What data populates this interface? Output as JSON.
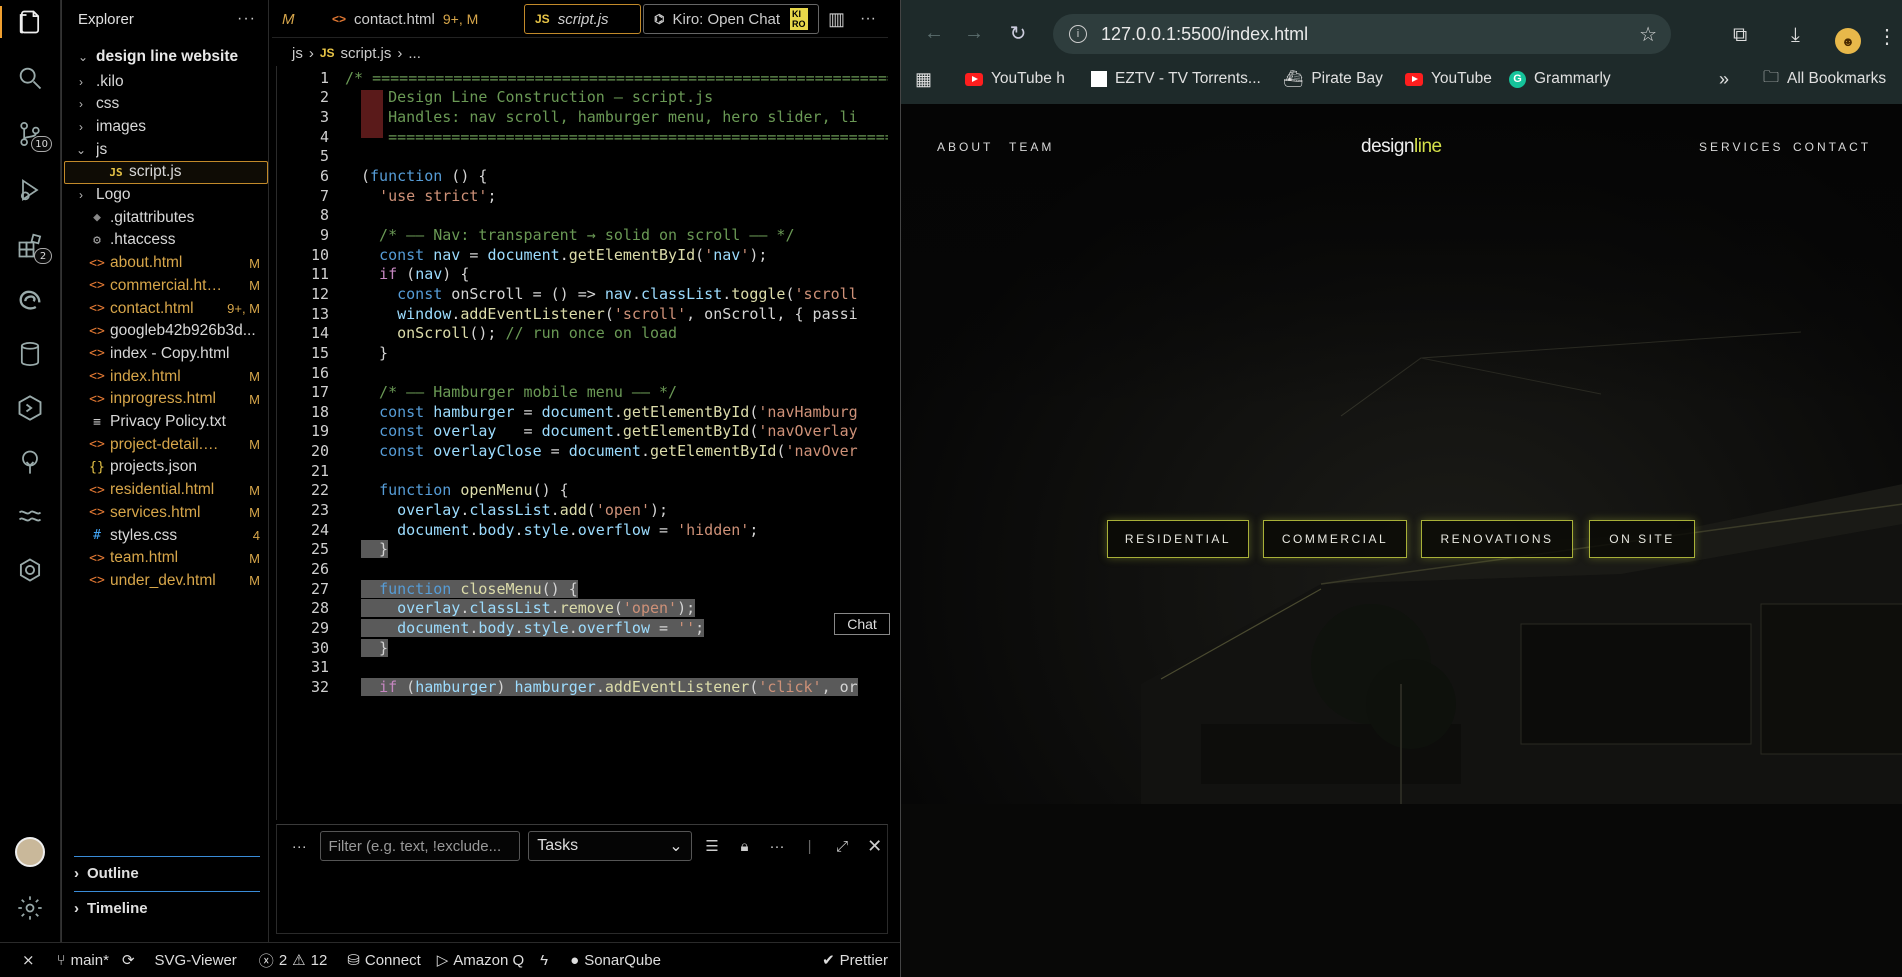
{
  "activity_bar": {
    "items": [
      {
        "name": "explorer",
        "icon": "files-icon"
      },
      {
        "name": "search",
        "icon": "search-icon"
      },
      {
        "name": "source-control",
        "icon": "source-control-icon",
        "badge": "10"
      },
      {
        "name": "run-debug",
        "icon": "debug-icon"
      },
      {
        "name": "extensions",
        "icon": "extensions-icon",
        "badge": "2"
      },
      {
        "name": "edge-tools",
        "icon": "edge-icon"
      },
      {
        "name": "database",
        "icon": "database-icon"
      },
      {
        "name": "kiro",
        "icon": "hex-icon"
      },
      {
        "name": "tree",
        "icon": "tree-icon"
      },
      {
        "name": "waves",
        "icon": "waves-icon"
      },
      {
        "name": "openai",
        "icon": "openai-icon"
      }
    ]
  },
  "explorer": {
    "title": "Explorer",
    "more": "···",
    "root": "design line website",
    "items": [
      {
        "label": ".kilo",
        "type": "folder",
        "depth": 1,
        "chev": "›"
      },
      {
        "label": "css",
        "type": "folder",
        "depth": 1,
        "chev": "›"
      },
      {
        "label": "images",
        "type": "folder",
        "depth": 1,
        "chev": "›"
      },
      {
        "label": "js",
        "type": "folder",
        "depth": 1,
        "chev": "⌄"
      },
      {
        "label": "script.js",
        "type": "js",
        "depth": 2,
        "selected": true
      },
      {
        "label": "Logo",
        "type": "folder",
        "depth": 1,
        "chev": "›"
      },
      {
        "label": ".gitattributes",
        "type": "git",
        "depth": 1
      },
      {
        "label": ".htaccess",
        "type": "gear",
        "depth": 1
      },
      {
        "label": "about.html",
        "type": "html",
        "depth": 1,
        "badge": "M"
      },
      {
        "label": "commercial.html",
        "type": "html",
        "depth": 1,
        "badge": "M"
      },
      {
        "label": "contact.html",
        "type": "html",
        "depth": 1,
        "badge": "9+, M"
      },
      {
        "label": "googleb42b926b3d...",
        "type": "html",
        "depth": 1
      },
      {
        "label": "index - Copy.html",
        "type": "html",
        "depth": 1
      },
      {
        "label": "index.html",
        "type": "html",
        "depth": 1,
        "badge": "M"
      },
      {
        "label": "inprogress.html",
        "type": "html",
        "depth": 1,
        "badge": "M"
      },
      {
        "label": "Privacy Policy.txt",
        "type": "txt",
        "depth": 1
      },
      {
        "label": "project-detail.ht...",
        "type": "html",
        "depth": 1,
        "badge": "M"
      },
      {
        "label": "projects.json",
        "type": "json",
        "depth": 1
      },
      {
        "label": "residential.html",
        "type": "html",
        "depth": 1,
        "badge": "M"
      },
      {
        "label": "services.html",
        "type": "html",
        "depth": 1,
        "badge": "M"
      },
      {
        "label": "styles.css",
        "type": "css",
        "depth": 1,
        "badge": "4"
      },
      {
        "label": "team.html",
        "type": "html",
        "depth": 1,
        "badge": "M"
      },
      {
        "label": "under_dev.html",
        "type": "html",
        "depth": 1,
        "badge": "M"
      }
    ],
    "outline": "Outline",
    "timeline": "Timeline"
  },
  "tabs": {
    "partial": "M",
    "contact": {
      "label": "contact.html",
      "badge": "9+, M"
    },
    "script": {
      "label": "script.js"
    },
    "kiro": {
      "label": "Kiro: Open Chat"
    }
  },
  "breadcrumb": {
    "folder": "js",
    "file": "script.js",
    "more": "..."
  },
  "editor": {
    "chat_tip": "Chat",
    "lines": [
      {
        "n": "1",
        "t": "/* =========================================================="
      },
      {
        "n": "2",
        "t": "   Design Line Construction — script.js"
      },
      {
        "n": "3",
        "t": "   Handles: nav scroll, hamburger menu, hero slider, li"
      },
      {
        "n": "4",
        "t": "   =========================================================="
      },
      {
        "n": "5",
        "t": ""
      },
      {
        "n": "6",
        "t": "(function () {"
      },
      {
        "n": "7",
        "t": "  'use strict';"
      },
      {
        "n": "8",
        "t": ""
      },
      {
        "n": "9",
        "t": "  /* —— Nav: transparent → solid on scroll —— */"
      },
      {
        "n": "10",
        "t": "  const nav = document.getElementById('nav');"
      },
      {
        "n": "11",
        "t": "  if (nav) {"
      },
      {
        "n": "12",
        "t": "    const onScroll = () => nav.classList.toggle('scroll"
      },
      {
        "n": "13",
        "t": "    window.addEventListener('scroll', onScroll, { passi"
      },
      {
        "n": "14",
        "t": "    onScroll(); // run once on load"
      },
      {
        "n": "15",
        "t": "  }"
      },
      {
        "n": "16",
        "t": ""
      },
      {
        "n": "17",
        "t": "  /* —— Hamburger mobile menu —— */"
      },
      {
        "n": "18",
        "t": "  const hamburger = document.getElementById('navHamburg"
      },
      {
        "n": "19",
        "t": "  const overlay   = document.getElementById('navOverlay"
      },
      {
        "n": "20",
        "t": "  const overlayClose = document.getElementById('navOver"
      },
      {
        "n": "21",
        "t": ""
      },
      {
        "n": "22",
        "t": "  function openMenu() {"
      },
      {
        "n": "23",
        "t": "    overlay.classList.add('open');"
      },
      {
        "n": "24",
        "t": "    document.body.style.overflow = 'hidden';"
      },
      {
        "n": "25",
        "t": "  }"
      },
      {
        "n": "26",
        "t": ""
      },
      {
        "n": "27",
        "t": "  function closeMenu() {"
      },
      {
        "n": "28",
        "t": "    overlay.classList.remove('open');"
      },
      {
        "n": "29",
        "t": "    document.body.style.overflow = '';"
      },
      {
        "n": "30",
        "t": "  }"
      },
      {
        "n": "31",
        "t": ""
      },
      {
        "n": "32",
        "t": "  if (hamburger) hamburger.addEventListener('click', or"
      }
    ]
  },
  "panel": {
    "more": "···",
    "filter_placeholder": "Filter (e.g. text, !exclude...",
    "tasks": "Tasks"
  },
  "statusbar": {
    "branch": "main*",
    "svg_viewer": "SVG-Viewer",
    "errors": "2",
    "warnings": "12",
    "connect": "Connect",
    "amazon_q": "Amazon Q",
    "sonarqube": "SonarQube",
    "prettier": "Prettier"
  },
  "browser": {
    "url": "127.0.0.1:5500/index.html",
    "bookmarks": [
      "YouTube h",
      "EZTV - TV Torrents...",
      "Pirate Bay",
      "YouTube",
      "Grammarly"
    ],
    "all_bookmarks": "All Bookmarks"
  },
  "site": {
    "nav_left": [
      "ABOUT",
      "TEAM"
    ],
    "logo_a": "design",
    "logo_b": "line",
    "nav_right": [
      "SERVICES",
      "CONTACT"
    ],
    "buttons": [
      "RESIDENTIAL",
      "COMMERCIAL",
      "RENOVATIONS",
      "ON SITE"
    ],
    "accent": "#d4e04a"
  }
}
